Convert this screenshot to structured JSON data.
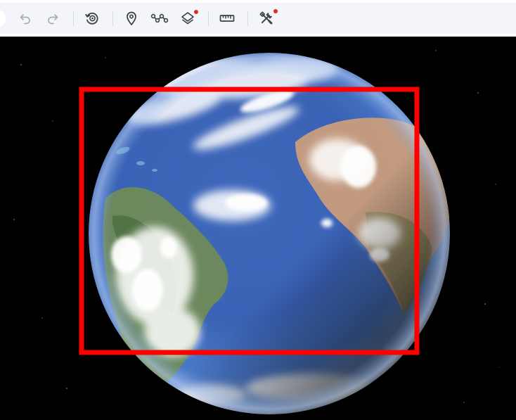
{
  "toolbar": {
    "buttons": [
      {
        "icon": "undo-icon",
        "enabled": false
      },
      {
        "icon": "redo-icon",
        "enabled": false
      },
      {
        "icon": "history-icon",
        "enabled": true
      },
      {
        "icon": "place-pin-icon",
        "enabled": true
      },
      {
        "icon": "path-icon",
        "enabled": true
      },
      {
        "icon": "layers-icon",
        "enabled": true,
        "badge": true
      },
      {
        "icon": "ruler-icon",
        "enabled": true
      },
      {
        "icon": "tools-icon",
        "enabled": true,
        "badge": true
      }
    ]
  },
  "colors": {
    "toolbar_bg": "#f3f5fa",
    "icon_active": "#3c4043",
    "icon_disabled": "#a8acb2",
    "badge": "#d93025",
    "highlight_box": "#ff0000",
    "ocean": "#3f6cc0",
    "space": "#000000"
  }
}
